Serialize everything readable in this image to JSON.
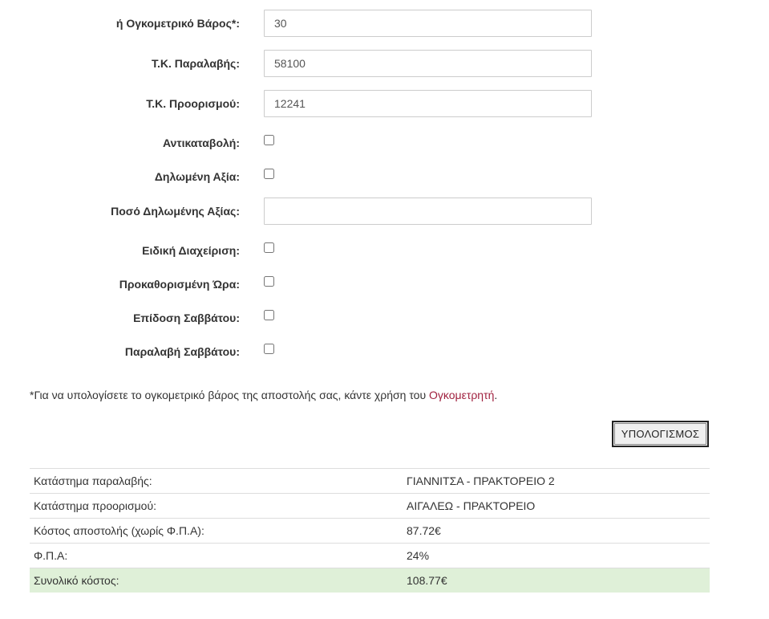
{
  "form": {
    "volumetric_weight": {
      "label": "ή Ογκομετρικό Βάρος*:",
      "value": "30"
    },
    "pickup_zip": {
      "label": "Τ.Κ. Παραλαβής:",
      "value": "58100"
    },
    "destination_zip": {
      "label": "Τ.Κ. Προορισμού:",
      "value": "12241"
    },
    "cash_on_delivery": {
      "label": "Αντικαταβολή:",
      "checked": false
    },
    "declared_value": {
      "label": "Δηλωμένη Αξία:",
      "checked": false
    },
    "declared_value_amount": {
      "label": "Ποσό Δηλωμένης Αξίας:",
      "value": ""
    },
    "special_handling": {
      "label": "Ειδική Διαχείριση:",
      "checked": false
    },
    "scheduled_time": {
      "label": "Προκαθορισμένη Ώρα:",
      "checked": false
    },
    "saturday_delivery": {
      "label": "Επίδοση Σαββάτου:",
      "checked": false
    },
    "saturday_pickup": {
      "label": "Παραλαβή Σαββάτου:",
      "checked": false
    }
  },
  "note": {
    "text_before": "*Για να υπολογίσετε το ογκομετρικό βάρος της αποστολής σας, κάντε χρήση του ",
    "link_text": "Ογκομετρητή",
    "text_after": "."
  },
  "calculate_button": {
    "label": "ΥΠΟΛΟΓΙΣΜΟΣ"
  },
  "results": {
    "pickup_store": {
      "label": "Κατάστημα παραλαβής:",
      "value": "ΓΙΑΝΝΙΤΣΑ - ΠΡΑΚΤΟΡΕΙΟ 2"
    },
    "destination_store": {
      "label": "Κατάστημα προορισμού:",
      "value": "ΑΙΓΑΛΕΩ - ΠΡΑΚΤΟΡΕΙΟ"
    },
    "shipping_cost": {
      "label": "Κόστος αποστολής (χωρίς Φ.Π.Α):",
      "value": "87.72€"
    },
    "vat": {
      "label": "Φ.Π.Α:",
      "value": "24%"
    },
    "total_cost": {
      "label": "Συνολικό κόστος:",
      "value": "108.77€"
    }
  },
  "colors": {
    "link": "#a0213f",
    "total_row_background": "#dff0d8"
  }
}
